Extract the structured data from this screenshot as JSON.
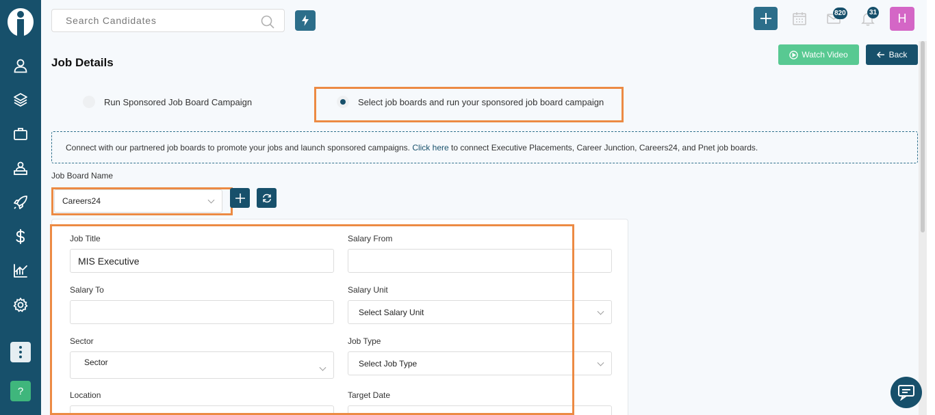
{
  "search": {
    "placeholder": "Search Candidates"
  },
  "header": {
    "mail_badge": "820",
    "notification_badge": "31",
    "avatar_initial": "H"
  },
  "page": {
    "title": "Job Details",
    "watch_video": "Watch Video",
    "back": "Back"
  },
  "campaign": {
    "option_1": "Run Sponsored Job Board Campaign",
    "option_2": "Select job boards and run your sponsored job board campaign",
    "selected": "option_2"
  },
  "info": {
    "text_before": "Connect with our partnered job boards to promote your jobs and launch sponsored campaigns.",
    "link": "Click here",
    "text_after": "to connect Executive Placements, Career Junction, Careers24, and Pnet job boards."
  },
  "job_board": {
    "label": "Job Board Name",
    "value": "Careers24"
  },
  "form": {
    "job_title": {
      "label": "Job Title",
      "value": "MIS Executive"
    },
    "salary_from": {
      "label": "Salary From",
      "value": ""
    },
    "salary_to": {
      "label": "Salary To",
      "value": ""
    },
    "salary_unit": {
      "label": "Salary Unit",
      "value": "Select Salary Unit"
    },
    "sector": {
      "label": "Sector",
      "value": "Sector"
    },
    "job_type": {
      "label": "Job Type",
      "value": "Select Job Type"
    },
    "location": {
      "label": "Location"
    },
    "target_date": {
      "label": "Target Date"
    }
  },
  "colors": {
    "sidebar": "#17506b",
    "accent": "#2c6e8a",
    "highlight": "#ec8a43",
    "watch": "#58c992",
    "avatar": "#d466c6"
  }
}
